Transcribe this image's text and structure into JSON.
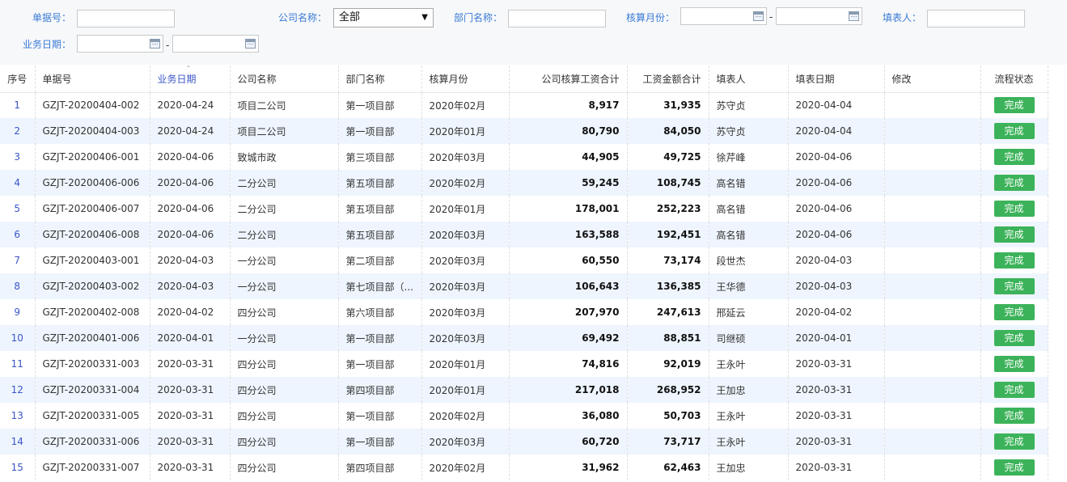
{
  "filters": {
    "doc_no_label": "单据号：",
    "company_label": "公司名称：",
    "company_value": "全部",
    "dept_label": "部门名称：",
    "month_label": "核算月份：",
    "filler_label": "填表人：",
    "biz_date_label": "业务日期：",
    "range_sep": "-"
  },
  "table": {
    "headers": {
      "seq": "序号",
      "doc_no": "单据号",
      "biz_date": "业务日期",
      "company": "公司名称",
      "dept": "部门名称",
      "month": "核算月份",
      "company_wage": "公司核算工资合计",
      "wage_total": "工资金额合计",
      "filler": "填表人",
      "fill_date": "填表日期",
      "edit": "修改",
      "status": "流程状态"
    },
    "rows": [
      {
        "seq": "1",
        "doc_no": "GZJT-20200404-002",
        "biz_date": "2020-04-24",
        "company": "项目二公司",
        "dept": "第一项目部",
        "month": "2020年02月",
        "company_wage": "8,917",
        "wage_total": "31,935",
        "filler": "苏守贞",
        "fill_date": "2020-04-04",
        "edit": "",
        "status": "完成"
      },
      {
        "seq": "2",
        "doc_no": "GZJT-20200404-003",
        "biz_date": "2020-04-24",
        "company": "项目二公司",
        "dept": "第一项目部",
        "month": "2020年01月",
        "company_wage": "80,790",
        "wage_total": "84,050",
        "filler": "苏守贞",
        "fill_date": "2020-04-04",
        "edit": "",
        "status": "完成"
      },
      {
        "seq": "3",
        "doc_no": "GZJT-20200406-001",
        "biz_date": "2020-04-06",
        "company": "致城市政",
        "dept": "第三项目部",
        "month": "2020年03月",
        "company_wage": "44,905",
        "wage_total": "49,725",
        "filler": "徐芹峰",
        "fill_date": "2020-04-06",
        "edit": "",
        "status": "完成"
      },
      {
        "seq": "4",
        "doc_no": "GZJT-20200406-006",
        "biz_date": "2020-04-06",
        "company": "二分公司",
        "dept": "第五项目部",
        "month": "2020年02月",
        "company_wage": "59,245",
        "wage_total": "108,745",
        "filler": "高名错",
        "fill_date": "2020-04-06",
        "edit": "",
        "status": "完成"
      },
      {
        "seq": "5",
        "doc_no": "GZJT-20200406-007",
        "biz_date": "2020-04-06",
        "company": "二分公司",
        "dept": "第五项目部",
        "month": "2020年01月",
        "company_wage": "178,001",
        "wage_total": "252,223",
        "filler": "高名错",
        "fill_date": "2020-04-06",
        "edit": "",
        "status": "完成"
      },
      {
        "seq": "6",
        "doc_no": "GZJT-20200406-008",
        "biz_date": "2020-04-06",
        "company": "二分公司",
        "dept": "第五项目部",
        "month": "2020年03月",
        "company_wage": "163,588",
        "wage_total": "192,451",
        "filler": "高名错",
        "fill_date": "2020-04-06",
        "edit": "",
        "status": "完成"
      },
      {
        "seq": "7",
        "doc_no": "GZJT-20200403-001",
        "biz_date": "2020-04-03",
        "company": "一分公司",
        "dept": "第二项目部",
        "month": "2020年03月",
        "company_wage": "60,550",
        "wage_total": "73,174",
        "filler": "段世杰",
        "fill_date": "2020-04-03",
        "edit": "",
        "status": "完成"
      },
      {
        "seq": "8",
        "doc_no": "GZJT-20200403-002",
        "biz_date": "2020-04-03",
        "company": "一分公司",
        "dept": "第七项目部（...",
        "month": "2020年03月",
        "company_wage": "106,643",
        "wage_total": "136,385",
        "filler": "王华德",
        "fill_date": "2020-04-03",
        "edit": "",
        "status": "完成"
      },
      {
        "seq": "9",
        "doc_no": "GZJT-20200402-008",
        "biz_date": "2020-04-02",
        "company": "四分公司",
        "dept": "第六项目部",
        "month": "2020年03月",
        "company_wage": "207,970",
        "wage_total": "247,613",
        "filler": "邢延云",
        "fill_date": "2020-04-02",
        "edit": "",
        "status": "完成"
      },
      {
        "seq": "10",
        "doc_no": "GZJT-20200401-006",
        "biz_date": "2020-04-01",
        "company": "一分公司",
        "dept": "第一项目部",
        "month": "2020年03月",
        "company_wage": "69,492",
        "wage_total": "88,851",
        "filler": "司继硕",
        "fill_date": "2020-04-01",
        "edit": "",
        "status": "完成"
      },
      {
        "seq": "11",
        "doc_no": "GZJT-20200331-003",
        "biz_date": "2020-03-31",
        "company": "四分公司",
        "dept": "第一项目部",
        "month": "2020年01月",
        "company_wage": "74,816",
        "wage_total": "92,019",
        "filler": "王永叶",
        "fill_date": "2020-03-31",
        "edit": "",
        "status": "完成"
      },
      {
        "seq": "12",
        "doc_no": "GZJT-20200331-004",
        "biz_date": "2020-03-31",
        "company": "四分公司",
        "dept": "第四项目部",
        "month": "2020年01月",
        "company_wage": "217,018",
        "wage_total": "268,952",
        "filler": "王加忠",
        "fill_date": "2020-03-31",
        "edit": "",
        "status": "完成"
      },
      {
        "seq": "13",
        "doc_no": "GZJT-20200331-005",
        "biz_date": "2020-03-31",
        "company": "四分公司",
        "dept": "第一项目部",
        "month": "2020年02月",
        "company_wage": "36,080",
        "wage_total": "50,703",
        "filler": "王永叶",
        "fill_date": "2020-03-31",
        "edit": "",
        "status": "完成"
      },
      {
        "seq": "14",
        "doc_no": "GZJT-20200331-006",
        "biz_date": "2020-03-31",
        "company": "四分公司",
        "dept": "第一项目部",
        "month": "2020年03月",
        "company_wage": "60,720",
        "wage_total": "73,717",
        "filler": "王永叶",
        "fill_date": "2020-03-31",
        "edit": "",
        "status": "完成"
      },
      {
        "seq": "15",
        "doc_no": "GZJT-20200331-007",
        "biz_date": "2020-03-31",
        "company": "四分公司",
        "dept": "第四项目部",
        "month": "2020年02月",
        "company_wage": "31,962",
        "wage_total": "62,463",
        "filler": "王加忠",
        "fill_date": "2020-03-31",
        "edit": "",
        "status": "完成"
      }
    ]
  },
  "colors": {
    "label_blue": "#3a7bd5",
    "link_blue": "#3a55c9",
    "row_alt": "#eef5fe",
    "status_green": "#3cb35a"
  },
  "icons": {
    "calendar": "calendar-icon",
    "dropdown": "chevron-down-icon"
  }
}
